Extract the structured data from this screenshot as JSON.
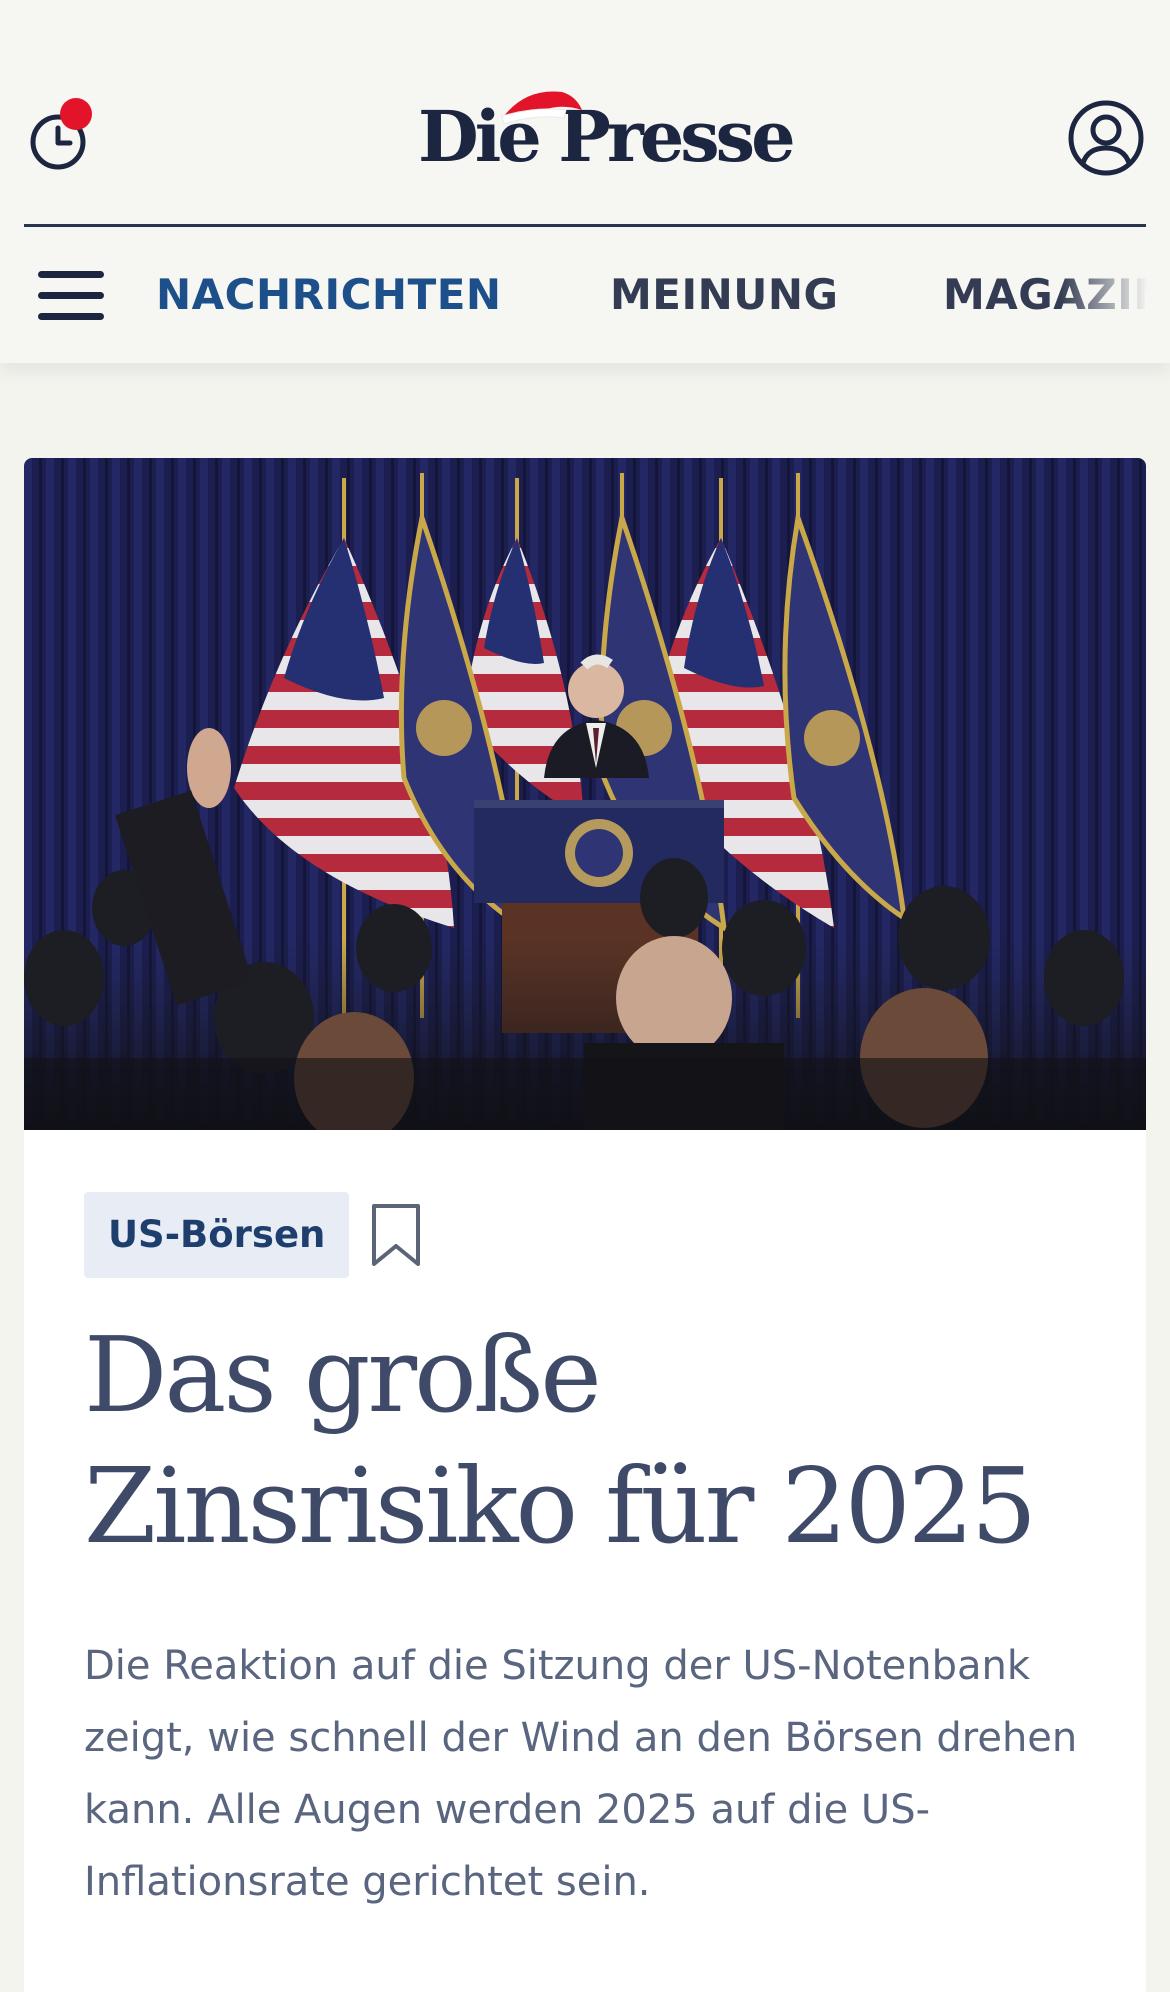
{
  "header": {
    "logo_text": "Die Presse",
    "history_icon": "clock-history-icon",
    "notification_color": "#e3142a",
    "user_icon": "user-account-icon"
  },
  "nav": {
    "menu_icon": "hamburger-menu-icon",
    "items": [
      {
        "label": "NACHRICHTEN",
        "active": true
      },
      {
        "label": "MEINUNG",
        "active": false
      },
      {
        "label": "MAGAZIN",
        "active": false
      }
    ],
    "active_color": "#1d4f8a"
  },
  "article": {
    "image_icon": "press-conference-photo",
    "tag": "US-Börsen",
    "bookmark_icon": "bookmark-icon",
    "headline": "Das große Zinsrisiko für 2025",
    "lead": "Die Reaktion auf die Sitzung der US-Notenbank zeigt, wie schnell der Wind an den Börsen drehen kann. Alle Augen werden 2025 auf die US-Inflationsrate gerichtet sein."
  }
}
